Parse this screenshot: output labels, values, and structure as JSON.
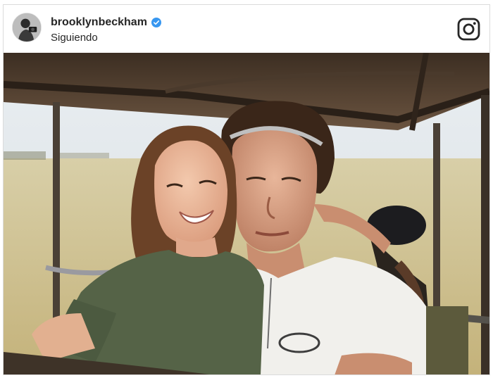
{
  "post": {
    "username": "brooklynbeckham",
    "status": "Siguiendo",
    "verified": true,
    "verified_color": "#3897f0",
    "avatar_icon": "profile-photo",
    "platform_icon": "instagram-icon",
    "photo_description_icon": "safari-vehicle-photo"
  },
  "colors": {
    "text": "#262626",
    "border": "#dbdbdb"
  }
}
